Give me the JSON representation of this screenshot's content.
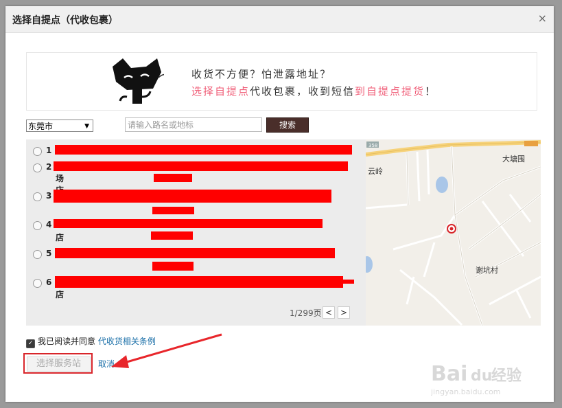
{
  "dialog": {
    "title": "选择自提点（代收包裹）",
    "close_glyph": "×"
  },
  "banner": {
    "line1": "收货不方便？怕泄露地址？",
    "line2_a": "选择自提点",
    "line2_b": "代收包裹，收到短信",
    "line2_c": "到自提点提货",
    "line2_d": "！"
  },
  "search": {
    "city_value": "东莞市",
    "placeholder": "请输入路名或地标",
    "button_label": "搜索"
  },
  "list": {
    "items": [
      {
        "num": "1",
        "sub": ""
      },
      {
        "num": "2",
        "sub": "场店"
      },
      {
        "num": "3",
        "sub": ""
      },
      {
        "num": "4",
        "sub": "店"
      },
      {
        "num": "5",
        "sub": ""
      },
      {
        "num": "6",
        "sub": "店"
      }
    ],
    "pager_text": "1/299页",
    "prev_glyph": "<",
    "next_glyph": ">"
  },
  "map": {
    "label_1": "大塘围",
    "label_2": "谢坑村",
    "label_3": "云岭",
    "road_num": "358"
  },
  "footer": {
    "agree_text": "我已阅读并同意",
    "agree_link": "代收货相关条例",
    "select_button": "选择服务站",
    "cancel": "取消"
  },
  "watermark": {
    "brand": "Bai",
    "brand2": "du",
    "brand_cn": "经验",
    "url": "jingyan.baidu.com"
  },
  "colors": {
    "redact": "#ff0000",
    "accent_pink": "#f0607a",
    "link_blue": "#1a6fa8",
    "search_btn": "#4a2e2a"
  }
}
